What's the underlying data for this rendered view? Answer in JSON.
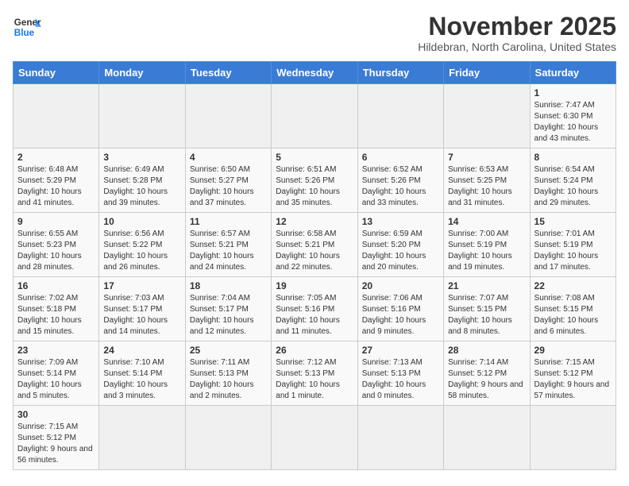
{
  "header": {
    "logo_general": "General",
    "logo_blue": "Blue",
    "title": "November 2025",
    "location": "Hildebran, North Carolina, United States"
  },
  "weekdays": [
    "Sunday",
    "Monday",
    "Tuesday",
    "Wednesday",
    "Thursday",
    "Friday",
    "Saturday"
  ],
  "weeks": [
    [
      {
        "day": "",
        "info": ""
      },
      {
        "day": "",
        "info": ""
      },
      {
        "day": "",
        "info": ""
      },
      {
        "day": "",
        "info": ""
      },
      {
        "day": "",
        "info": ""
      },
      {
        "day": "",
        "info": ""
      },
      {
        "day": "1",
        "info": "Sunrise: 7:47 AM\nSunset: 6:30 PM\nDaylight: 10 hours and 43 minutes."
      }
    ],
    [
      {
        "day": "2",
        "info": "Sunrise: 6:48 AM\nSunset: 5:29 PM\nDaylight: 10 hours and 41 minutes."
      },
      {
        "day": "3",
        "info": "Sunrise: 6:49 AM\nSunset: 5:28 PM\nDaylight: 10 hours and 39 minutes."
      },
      {
        "day": "4",
        "info": "Sunrise: 6:50 AM\nSunset: 5:27 PM\nDaylight: 10 hours and 37 minutes."
      },
      {
        "day": "5",
        "info": "Sunrise: 6:51 AM\nSunset: 5:26 PM\nDaylight: 10 hours and 35 minutes."
      },
      {
        "day": "6",
        "info": "Sunrise: 6:52 AM\nSunset: 5:26 PM\nDaylight: 10 hours and 33 minutes."
      },
      {
        "day": "7",
        "info": "Sunrise: 6:53 AM\nSunset: 5:25 PM\nDaylight: 10 hours and 31 minutes."
      },
      {
        "day": "8",
        "info": "Sunrise: 6:54 AM\nSunset: 5:24 PM\nDaylight: 10 hours and 29 minutes."
      }
    ],
    [
      {
        "day": "9",
        "info": "Sunrise: 6:55 AM\nSunset: 5:23 PM\nDaylight: 10 hours and 28 minutes."
      },
      {
        "day": "10",
        "info": "Sunrise: 6:56 AM\nSunset: 5:22 PM\nDaylight: 10 hours and 26 minutes."
      },
      {
        "day": "11",
        "info": "Sunrise: 6:57 AM\nSunset: 5:21 PM\nDaylight: 10 hours and 24 minutes."
      },
      {
        "day": "12",
        "info": "Sunrise: 6:58 AM\nSunset: 5:21 PM\nDaylight: 10 hours and 22 minutes."
      },
      {
        "day": "13",
        "info": "Sunrise: 6:59 AM\nSunset: 5:20 PM\nDaylight: 10 hours and 20 minutes."
      },
      {
        "day": "14",
        "info": "Sunrise: 7:00 AM\nSunset: 5:19 PM\nDaylight: 10 hours and 19 minutes."
      },
      {
        "day": "15",
        "info": "Sunrise: 7:01 AM\nSunset: 5:19 PM\nDaylight: 10 hours and 17 minutes."
      }
    ],
    [
      {
        "day": "16",
        "info": "Sunrise: 7:02 AM\nSunset: 5:18 PM\nDaylight: 10 hours and 15 minutes."
      },
      {
        "day": "17",
        "info": "Sunrise: 7:03 AM\nSunset: 5:17 PM\nDaylight: 10 hours and 14 minutes."
      },
      {
        "day": "18",
        "info": "Sunrise: 7:04 AM\nSunset: 5:17 PM\nDaylight: 10 hours and 12 minutes."
      },
      {
        "day": "19",
        "info": "Sunrise: 7:05 AM\nSunset: 5:16 PM\nDaylight: 10 hours and 11 minutes."
      },
      {
        "day": "20",
        "info": "Sunrise: 7:06 AM\nSunset: 5:16 PM\nDaylight: 10 hours and 9 minutes."
      },
      {
        "day": "21",
        "info": "Sunrise: 7:07 AM\nSunset: 5:15 PM\nDaylight: 10 hours and 8 minutes."
      },
      {
        "day": "22",
        "info": "Sunrise: 7:08 AM\nSunset: 5:15 PM\nDaylight: 10 hours and 6 minutes."
      }
    ],
    [
      {
        "day": "23",
        "info": "Sunrise: 7:09 AM\nSunset: 5:14 PM\nDaylight: 10 hours and 5 minutes."
      },
      {
        "day": "24",
        "info": "Sunrise: 7:10 AM\nSunset: 5:14 PM\nDaylight: 10 hours and 3 minutes."
      },
      {
        "day": "25",
        "info": "Sunrise: 7:11 AM\nSunset: 5:13 PM\nDaylight: 10 hours and 2 minutes."
      },
      {
        "day": "26",
        "info": "Sunrise: 7:12 AM\nSunset: 5:13 PM\nDaylight: 10 hours and 1 minute."
      },
      {
        "day": "27",
        "info": "Sunrise: 7:13 AM\nSunset: 5:13 PM\nDaylight: 10 hours and 0 minutes."
      },
      {
        "day": "28",
        "info": "Sunrise: 7:14 AM\nSunset: 5:12 PM\nDaylight: 9 hours and 58 minutes."
      },
      {
        "day": "29",
        "info": "Sunrise: 7:15 AM\nSunset: 5:12 PM\nDaylight: 9 hours and 57 minutes."
      }
    ],
    [
      {
        "day": "30",
        "info": "Sunrise: 7:15 AM\nSunset: 5:12 PM\nDaylight: 9 hours and 56 minutes."
      },
      {
        "day": "",
        "info": ""
      },
      {
        "day": "",
        "info": ""
      },
      {
        "day": "",
        "info": ""
      },
      {
        "day": "",
        "info": ""
      },
      {
        "day": "",
        "info": ""
      },
      {
        "day": "",
        "info": ""
      }
    ]
  ]
}
